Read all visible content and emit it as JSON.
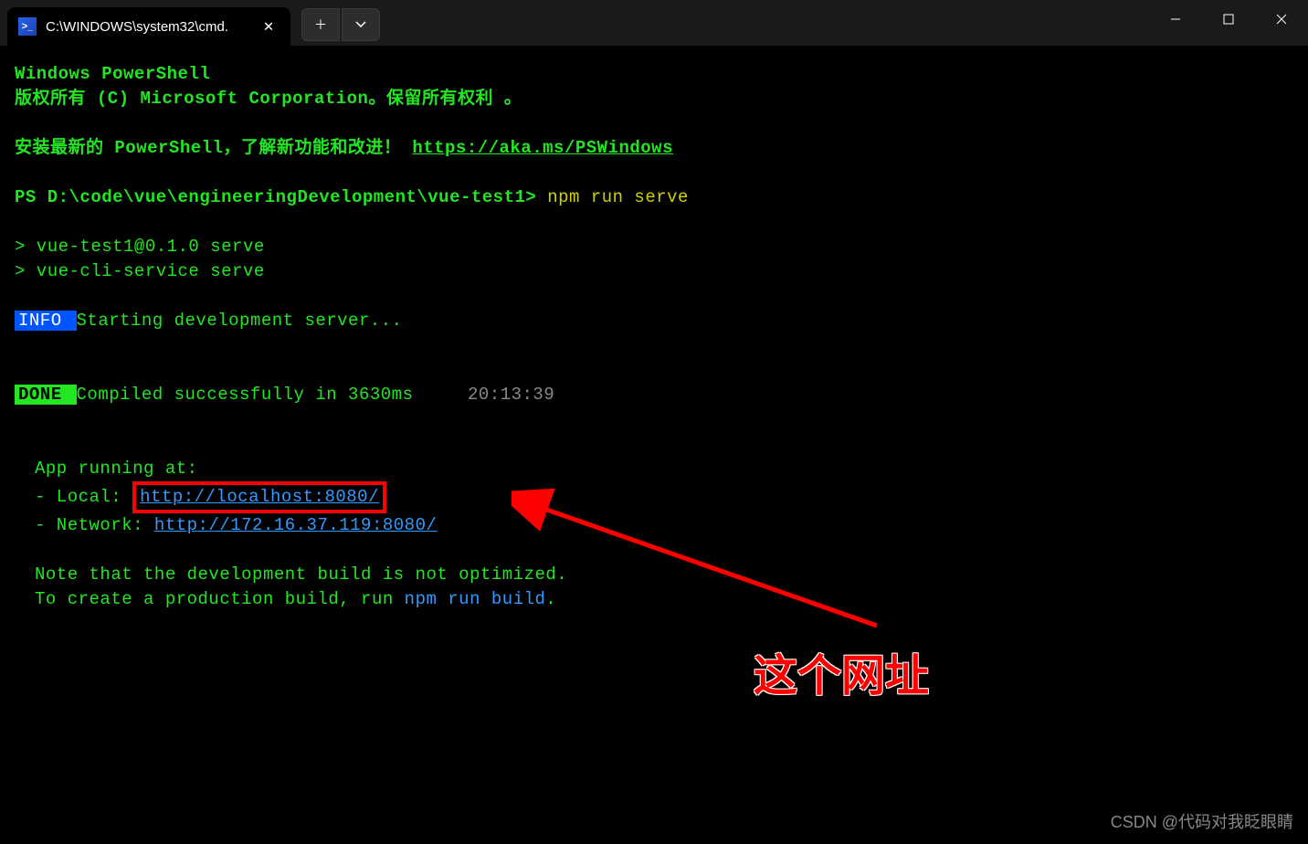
{
  "tab": {
    "title": "C:\\WINDOWS\\system32\\cmd."
  },
  "terminal": {
    "header1": "Windows PowerShell",
    "header2": "版权所有 (C)  Microsoft Corporation。保留所有权利 。",
    "install_msg": "安装最新的 PowerShell，了解新功能和改进！",
    "install_url": "https://aka.ms/PSWindows",
    "prompt": "PS D:\\code\\vue\\engineeringDevelopment\\vue-test1>",
    "command": "npm run serve",
    "script1": "> vue-test1@0.1.0 serve",
    "script2": "> vue-cli-service serve",
    "info_label": " INFO ",
    "info_msg": "Starting development server...",
    "done_label": " DONE ",
    "done_msg": "Compiled successfully in 3630ms",
    "done_time": "20:13:39",
    "app_running": "App running at:",
    "local_label": "- Local:   ",
    "local_url": "http://localhost:8080/ ",
    "network_label": "- Network: ",
    "network_url": "http://172.16.37.119:8080/",
    "note1": "Note that the development build is not optimized.",
    "note2a": "To create a production build, run ",
    "note2b": "npm run build",
    "note2c": "."
  },
  "annotation": {
    "text": "这个网址"
  },
  "watermark": "CSDN @代码对我眨眼睛"
}
